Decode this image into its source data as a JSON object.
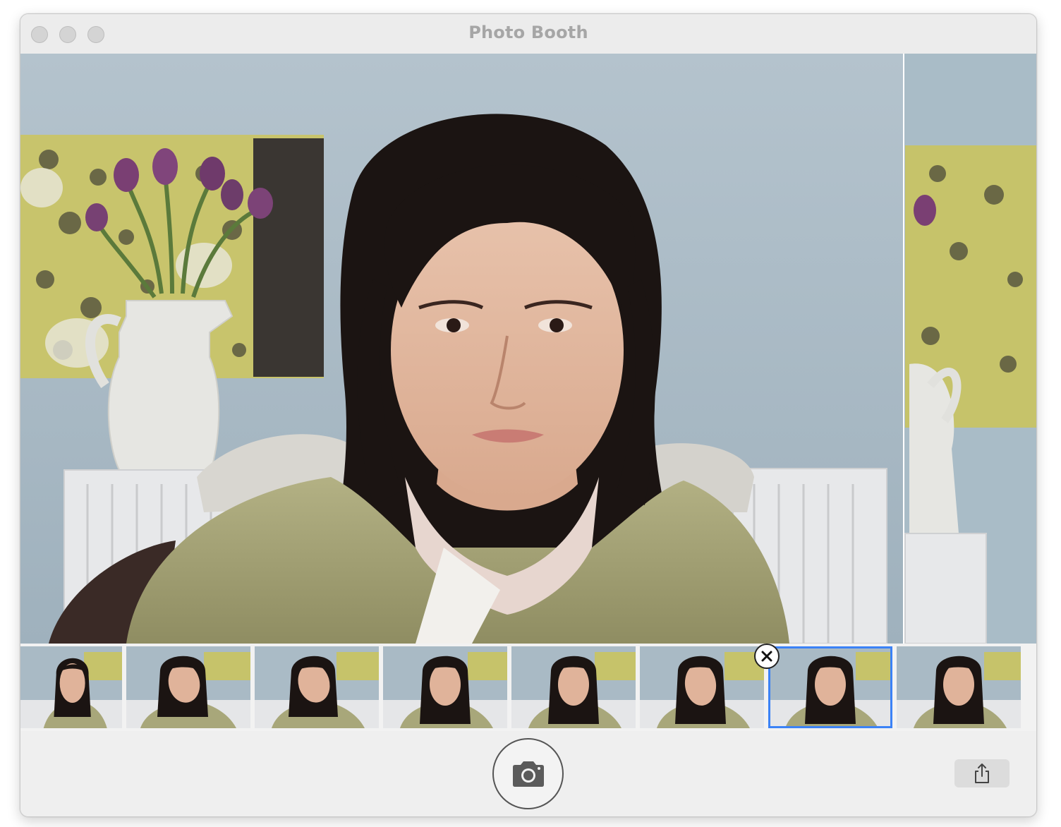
{
  "window": {
    "title": "Photo Booth"
  },
  "traffic_lights": [
    "close",
    "minimize",
    "zoom"
  ],
  "preview": {
    "description_icon": "live-camera-feed"
  },
  "filmstrip": {
    "count": 8,
    "selected_index": 6,
    "delete_badge_icon": "close-x-icon"
  },
  "toolbar": {
    "shutter_icon": "camera-icon",
    "share_icon": "share-icon"
  },
  "colors": {
    "selection": "#3b82f6",
    "wall": "#a8b9c4",
    "jacket": "#a8a77a",
    "hair": "#1b1412"
  }
}
